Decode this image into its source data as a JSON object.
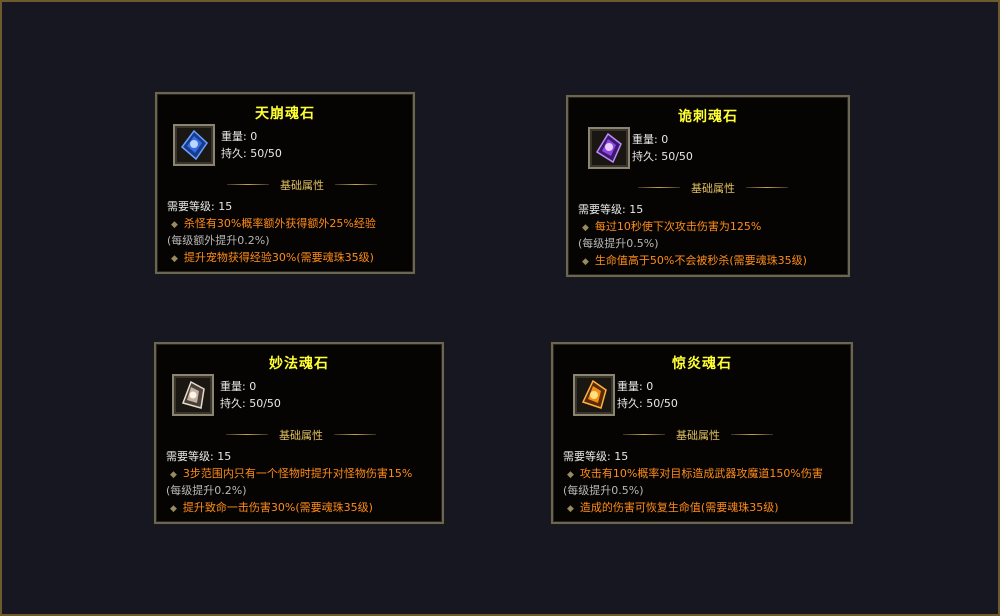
{
  "cards": [
    {
      "title": "天崩魂石",
      "weight": "重量: 0",
      "durability": "持久: 50/50",
      "section": "基础属性",
      "req_level": "需要等级: 15",
      "effect1": "杀怪有30%概率额外获得额外25%经验",
      "per_level": "(每级额外提升0.2%)",
      "effect2": "提升宠物获得经验30%(需要魂珠35级)",
      "icon": "blue-soul-stone-icon",
      "gem_color": "#3a7bff"
    },
    {
      "title": "诡刺魂石",
      "weight": "重量: 0",
      "durability": "持久: 50/50",
      "section": "基础属性",
      "req_level": "需要等级: 15",
      "effect1": "每过10秒使下次攻击伤害为125%",
      "per_level": "(每级提升0.5%)",
      "effect2": "生命值高于50%不会被秒杀(需要魂珠35级)",
      "icon": "purple-soul-stone-icon",
      "gem_color": "#a24cff"
    },
    {
      "title": "妙法魂石",
      "weight": "重量: 0",
      "durability": "持久: 50/50",
      "section": "基础属性",
      "req_level": "需要等级: 15",
      "effect1": "3步范围内只有一个怪物时提升对怪物伤害15%",
      "per_level": "(每级提升0.2%)",
      "effect2": "提升致命一击伤害30%(需要魂珠35级)",
      "icon": "white-soul-stone-icon",
      "gem_color": "#d8c8b8"
    },
    {
      "title": "惊炎魂石",
      "weight": "重量: 0",
      "durability": "持久: 50/50",
      "section": "基础属性",
      "req_level": "需要等级: 15",
      "effect1": "攻击有10%概率对目标造成武器攻魔道150%伤害",
      "per_level": "(每级提升0.5%)",
      "effect2": "造成的伤害可恢复生命值(需要魂珠35级)",
      "icon": "fire-soul-stone-icon",
      "gem_color": "#ff9a1a"
    }
  ]
}
